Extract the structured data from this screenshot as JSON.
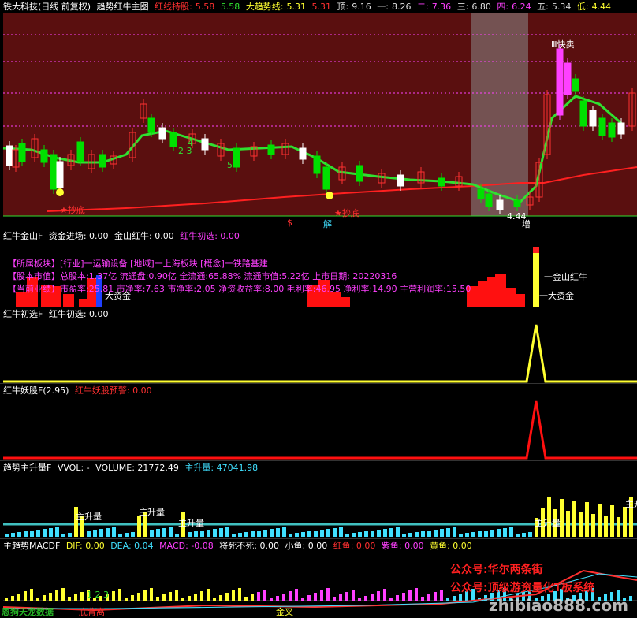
{
  "main_header": {
    "stock": "铁大科技(日线 前复权)",
    "indicator": "趋势红牛主图",
    "red_line_label": "红线持股:",
    "red_line_value": "5.58",
    "green_value": "5.58",
    "big_trend_label": "大趋势线:",
    "big_trend_value": "5.31",
    "v1": "5.31",
    "top_label": "顶:",
    "top_value": "9.16",
    "one_label": "一:",
    "one_value": "8.26",
    "two_label": "二:",
    "two_value": "7.36",
    "three_label": "三:",
    "three_value": "6.80",
    "four_label": "四:",
    "four_value": "6.24",
    "five_label": "五:",
    "five_value": "5.34",
    "low_label": "低:",
    "low_value": "4.44"
  },
  "main_annotations": {
    "buy_bottom_1": "★抄底",
    "buy_bottom_2": "★抄底",
    "quick_sell": "Ⅲ快卖",
    "dollar_mark": "$",
    "jie_mark": "解",
    "zeng_mark": "增",
    "low_price": "4.44",
    "nums_a": "2 3",
    "nums_b": "4",
    "nums_c": "5"
  },
  "panel2": {
    "title": "红牛金山F",
    "item1": "资金进场: 0.00",
    "item2": "金山红牛: 0.00",
    "item3": "红牛初选: 0.00",
    "info_line1": "【所属板块】[行业]一运输设备 [地域]一上海板块 [概念]一铁路基建",
    "info_line2": "【股本市值】总股本:1.37亿 流通盘:0.90亿 全流通:65.88% 流通市值:5.22亿 上市日期: 20220316",
    "info_line3": "【当前业绩】市盈率:25.81 市净率:7.63 市净率:2.05 净资收益率:8.00 毛利率:46.95 净利率:14.90 主营利润率:15.50",
    "label_bigfund": "大资金",
    "label_jinshan": "一金山红牛",
    "label_bigfund2": "一大资金"
  },
  "panel3": {
    "title": "红牛初选F",
    "item1": "红牛初选: 0.00"
  },
  "panel4": {
    "title": "红牛妖股F(2.95)",
    "item1": "红牛妖股预警: 0.00"
  },
  "panel5": {
    "title": "趋势主升量F",
    "vol_label": "VVOL: -",
    "volume": "VOLUME: 21772.49",
    "zhusheng": "主升量: 47041.98",
    "tag1": "主升量",
    "tag2": "主升量",
    "tag3": "主升量",
    "tag4": "主升量",
    "tag5": "主升"
  },
  "panel6": {
    "title": "主趋势MACDF",
    "dif": "DIF: 0.00",
    "dea": "DEA: 0.04",
    "macd": "MACD: -0.08",
    "jiangsi": "将死不死: 0.00",
    "xiaoyu": "小鱼: 0.00",
    "hongyu": "红鱼: 0.00",
    "ziyu": "紫鱼: 0.00",
    "huangyu": "黄鱼: 0.00",
    "bottom_div": "底背离",
    "gaogong": "金叉",
    "nums": "1 2 3"
  },
  "watermarks": {
    "wm1": "公众号:华尔两条街",
    "wm2": "公众号:顶级游资量化T板系统",
    "wm3": "zhibiao888.com",
    "wm4": "恩狗天龙数据"
  },
  "colors": {
    "bg_main": "#5a0f0f",
    "up": "#ff3030",
    "down": "#00e000",
    "trend_red": "#ff2020",
    "trend_green": "#30e030",
    "magenta": "#ff40ff",
    "yellow": "#ffff30",
    "cyan": "#40e0ff"
  }
}
